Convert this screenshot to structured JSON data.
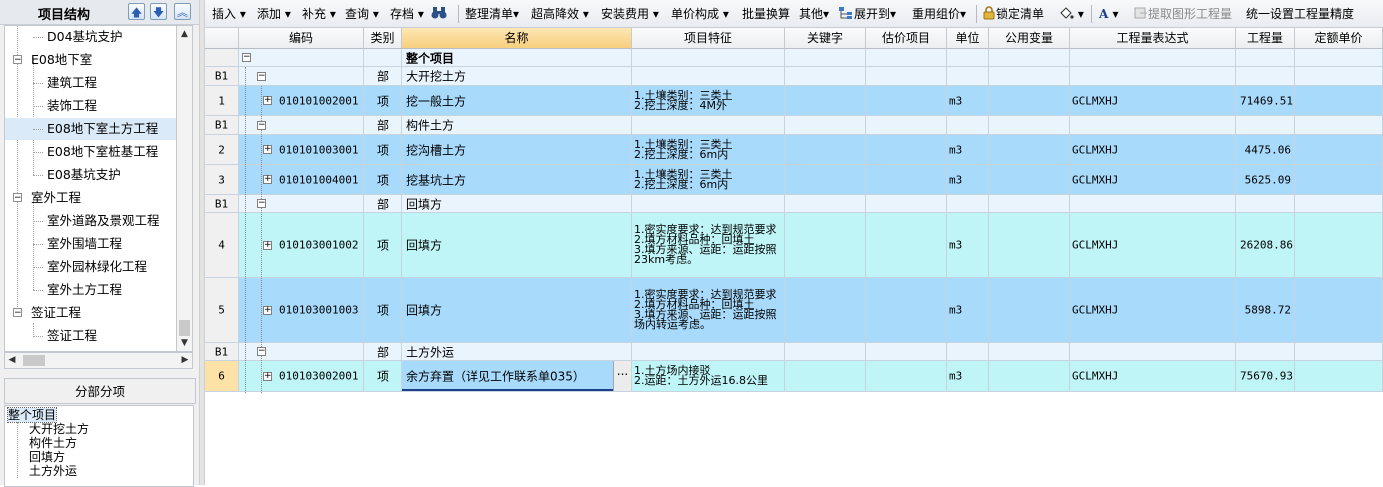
{
  "left_panel": {
    "title": "项目结构",
    "tree": [
      {
        "label": "D04基坑支护"
      },
      {
        "label": "E08地下室"
      },
      {
        "label": "建筑工程"
      },
      {
        "label": "装饰工程"
      },
      {
        "label": "E08地下室土方工程"
      },
      {
        "label": "E08地下室桩基工程"
      },
      {
        "label": "E08基坑支护"
      },
      {
        "label": "室外工程"
      },
      {
        "label": "室外道路及景观工程"
      },
      {
        "label": "室外围墙工程"
      },
      {
        "label": "室外园林绿化工程"
      },
      {
        "label": "室外土方工程"
      },
      {
        "label": "签证工程"
      },
      {
        "label": "签证工程"
      }
    ],
    "section_title": "分部分项",
    "section_items": [
      "整个项目",
      "大开挖土方",
      "构件土方",
      "回填方",
      "土方外运"
    ]
  },
  "toolbar": {
    "insert": "插入",
    "add": "添加",
    "supplement": "补充",
    "query": "查询",
    "archive": "存档",
    "organize_list": "整理清单",
    "super_high_reduction": "超高降效",
    "install_fee": "安装费用",
    "unit_price_composition": "单价构成",
    "batch_conversion": "批量换算",
    "other": "其他",
    "expand_to": "展开到",
    "reuse_pricing": "重用组价",
    "lock_list": "锁定清单",
    "font_a": "A",
    "extract_quantity": "提取图形工程量",
    "unify_precision": "统一设置工程量精度"
  },
  "grid": {
    "headers": {
      "code": "编码",
      "type": "类别",
      "name": "名称",
      "feature": "项目特征",
      "keyword": "关键字",
      "estimate": "估价项目",
      "unit": "单位",
      "public_var": "公用变量",
      "expr": "工程量表达式",
      "qty": "工程量",
      "unit_price": "定额单价"
    },
    "total_row": {
      "name": "整个项目"
    },
    "rows": [
      {
        "num": "B1",
        "code": "",
        "type": "部",
        "name": "大开挖土方"
      },
      {
        "num": "1",
        "code": "010101002001",
        "type": "项",
        "name": "挖一般土方",
        "feature": "1.土壤类别：三类土\n2.挖土深度：4M外",
        "unit": "m3",
        "expr": "GCLMXHJ",
        "qty": "71469.51"
      },
      {
        "num": "B1",
        "code": "",
        "type": "部",
        "name": "构件土方"
      },
      {
        "num": "2",
        "code": "010101003001",
        "type": "项",
        "name": "挖沟槽土方",
        "feature": "1.土壤类别：三类土\n2.挖土深度：6m内",
        "unit": "m3",
        "expr": "GCLMXHJ",
        "qty": "4475.06"
      },
      {
        "num": "3",
        "code": "010101004001",
        "type": "项",
        "name": "挖基坑土方",
        "feature": "1.土壤类别：三类土\n2.挖土深度：6m内",
        "unit": "m3",
        "expr": "GCLMXHJ",
        "qty": "5625.09"
      },
      {
        "num": "B1",
        "code": "",
        "type": "部",
        "name": "回填方"
      },
      {
        "num": "4",
        "code": "010103001002",
        "type": "项",
        "name": "回填方",
        "feature": "1.密实度要求：达到规范要求\n2.填方材料品种：回填土\n3.填方来源、运距：运距按照23km考虑。",
        "unit": "m3",
        "expr": "GCLMXHJ",
        "qty": "26208.86"
      },
      {
        "num": "5",
        "code": "010103001003",
        "type": "项",
        "name": "回填方",
        "feature": "1.密实度要求：达到规范要求\n2.填方材料品种：回填土\n3.填方来源、运距：运距按照场内转运考虑。",
        "unit": "m3",
        "expr": "GCLMXHJ",
        "qty": "5898.72"
      },
      {
        "num": "B1",
        "code": "",
        "type": "部",
        "name": "土方外运"
      },
      {
        "num": "6",
        "code": "010103002001",
        "type": "项",
        "name": "余方弃置（详见工作联系单035）",
        "feature": "1.土方场内接驳\n2.运距：土方外运16.8公里",
        "unit": "m3",
        "expr": "GCLMXHJ",
        "qty": "75670.93"
      }
    ],
    "ellipsis": "..."
  }
}
